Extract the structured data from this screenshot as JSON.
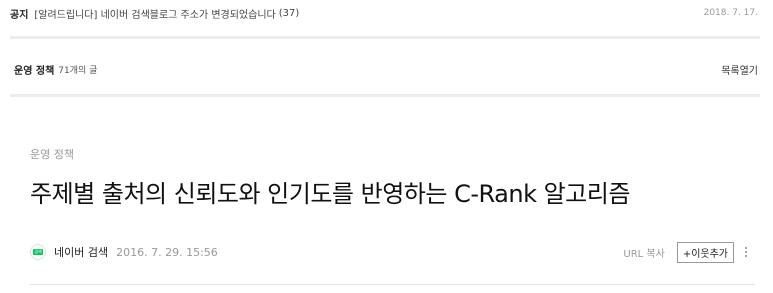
{
  "notice": {
    "tag": "공지",
    "text": "[알려드립니다] 네이버 검색블로그 주소가 변경되었습니다",
    "count": "(37)",
    "date": "2018. 7. 17."
  },
  "category_bar": {
    "name": "운영 정책",
    "count": "71개의 글",
    "toggle": "목록열기"
  },
  "post": {
    "category": "운영 정책",
    "title": "주제별 출처의 신뢰도와 인기도를 반영하는 C-Rank 알고리즘",
    "avatar_text": "검색",
    "author": "네이버 검색",
    "date": "2016. 7. 29. 15:56",
    "url_copy": "URL 복사",
    "add_neighbor": "+이웃추가"
  },
  "icons": {
    "more": "vertical-dots-icon",
    "avatar": "naver-avatar-icon"
  },
  "colors": {
    "brand": "#03c75a",
    "divider": "#ececec",
    "muted": "#999999"
  }
}
